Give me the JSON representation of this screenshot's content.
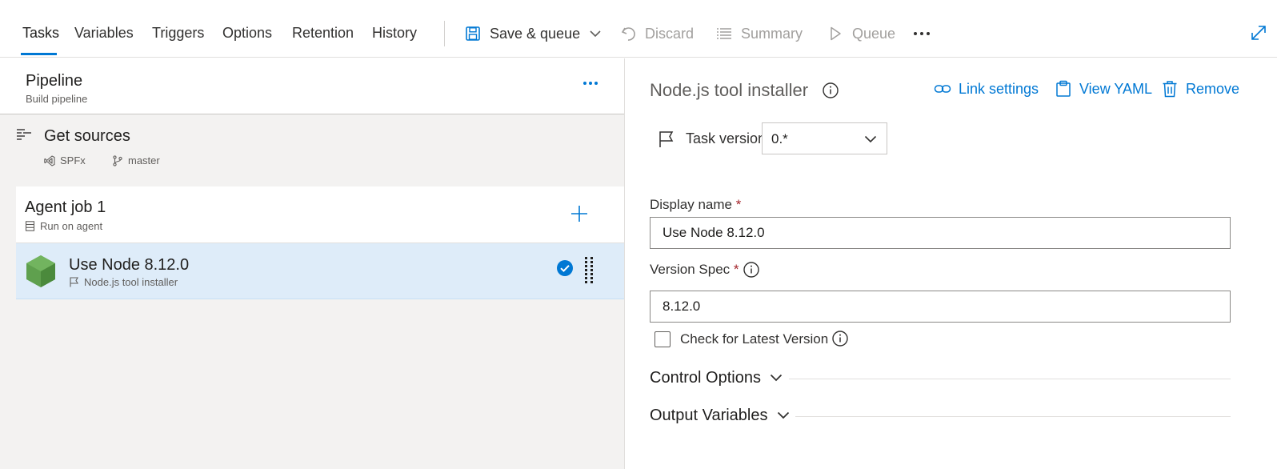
{
  "toolbar": {
    "tabs": [
      {
        "label": "Tasks",
        "active": true
      },
      {
        "label": "Variables"
      },
      {
        "label": "Triggers"
      },
      {
        "label": "Options"
      },
      {
        "label": "Retention"
      },
      {
        "label": "History"
      }
    ],
    "actions": {
      "save_queue": {
        "label": "Save & queue",
        "icon": "save-icon",
        "enabled": true
      },
      "discard": {
        "label": "Discard",
        "icon": "undo-icon",
        "enabled": false
      },
      "summary": {
        "label": "Summary",
        "icon": "list-icon",
        "enabled": false
      },
      "queue": {
        "label": "Queue",
        "icon": "play-icon",
        "enabled": false
      }
    },
    "more_icon": "ellipsis-icon",
    "expand_icon": "expand-icon"
  },
  "pipeline": {
    "title": "Pipeline",
    "subtitle": "Build pipeline"
  },
  "sources": {
    "title": "Get sources",
    "repo": "SPFx",
    "branch": "master"
  },
  "agent_job": {
    "title": "Agent job 1",
    "subtitle": "Run on agent"
  },
  "task": {
    "title": "Use Node 8.12.0",
    "subtitle": "Node.js tool installer",
    "selected": true
  },
  "details": {
    "title": "Node.js tool installer",
    "links": {
      "link_settings": "Link settings",
      "view_yaml": "View YAML",
      "remove": "Remove"
    },
    "task_version": {
      "label": "Task version",
      "value": "0.*"
    },
    "display_name": {
      "label": "Display name",
      "required_mark": "*",
      "value": "Use Node 8.12.0"
    },
    "version_spec": {
      "label": "Version Spec",
      "required_mark": "*",
      "value": "8.12.0"
    },
    "check_latest": {
      "label": "Check for Latest Version",
      "checked": false
    },
    "sections": {
      "control_options": "Control Options",
      "output_variables": "Output Variables"
    }
  },
  "colors": {
    "accent": "#0078d4",
    "selected_row": "#deecf9",
    "pane_background": "#f3f2f1",
    "node_green": "#5fa04e",
    "required": "#a4262c"
  }
}
